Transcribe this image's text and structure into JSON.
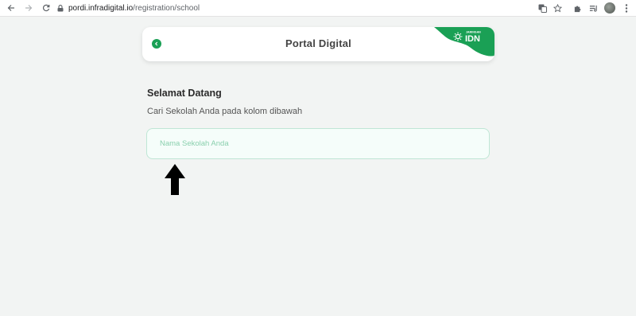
{
  "browser": {
    "url_domain": "pordi.infradigital.io",
    "url_path": "/registration/school"
  },
  "header": {
    "title": "Portal Digital",
    "brand_small": "JARINGAN",
    "brand_large": "IDN",
    "brand_color": "#1aa055"
  },
  "main": {
    "welcome": "Selamat Datang",
    "subtitle": "Cari Sekolah Anda pada kolom dibawah",
    "search_placeholder": "Nama Sekolah Anda"
  },
  "icons": [
    "back-arrow-icon",
    "forward-arrow-icon",
    "reload-icon",
    "lock-icon",
    "translate-icon",
    "star-icon",
    "extensions-icon",
    "reading-list-icon",
    "menu-dots-icon",
    "chevron-left-icon",
    "idn-sun-logo-icon",
    "annotation-up-arrow-icon"
  ]
}
